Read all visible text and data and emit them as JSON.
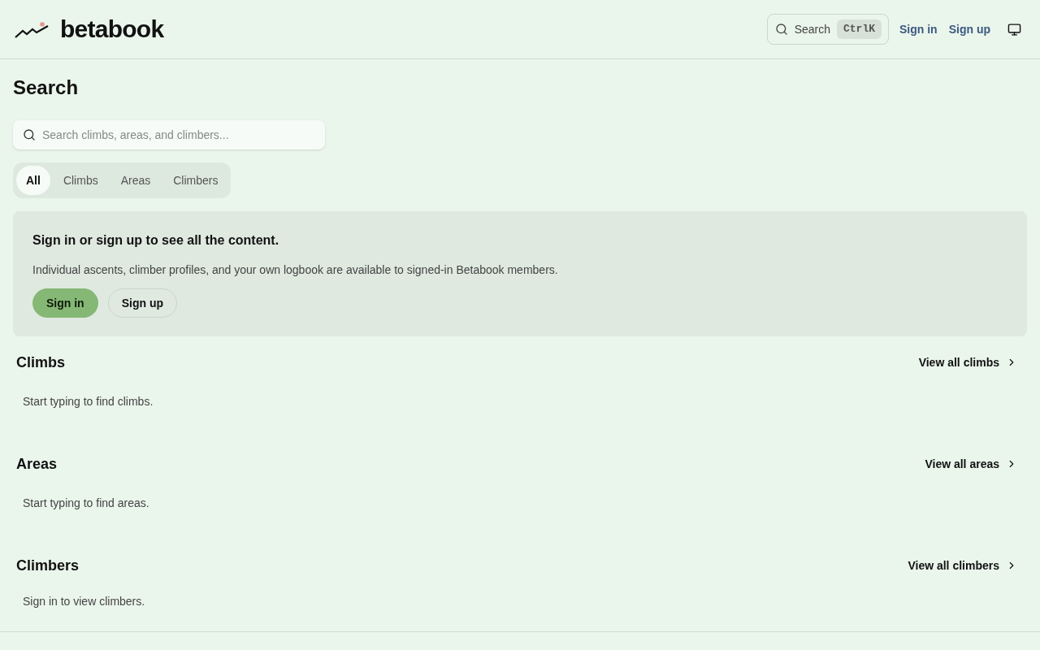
{
  "header": {
    "logo": "betabook",
    "search": {
      "label": "Search",
      "shortcut": "CtrlK"
    },
    "links": [
      "Sign in",
      "Sign up"
    ]
  },
  "page_title": "Search",
  "search": {
    "placeholder": "Search climbs, areas, and climbers..."
  },
  "tabs": [
    {
      "label": "All",
      "selected": true
    },
    {
      "label": "Climbs",
      "selected": false
    },
    {
      "label": "Areas",
      "selected": false
    },
    {
      "label": "Climbers",
      "selected": false
    }
  ],
  "notice": {
    "title": "Sign in or sign up to see all the content.",
    "text": "Individual ascents, climber profiles, and your own logbook are available to signed-in Betabook members.",
    "buttons": [
      {
        "label": "Sign in",
        "kind": "primary"
      },
      {
        "label": "Sign up",
        "kind": "secondary"
      }
    ]
  },
  "sections": [
    {
      "title": "Climbs",
      "link": "View all climbs",
      "message": "Start typing to find climbs."
    },
    {
      "title": "Areas",
      "link": "View all areas",
      "message": "Start typing to find areas."
    },
    {
      "title": "Climbers",
      "link": "View all climbers",
      "message": "Sign in to view climbers."
    }
  ]
}
